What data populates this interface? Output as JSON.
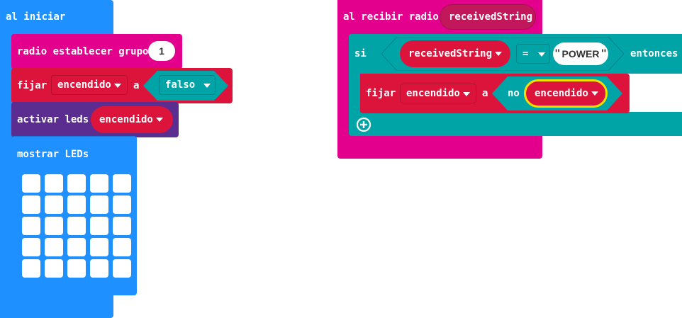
{
  "colors": {
    "basic": "#1E90FF",
    "radio": "#E3008C",
    "variables": "#DC143C",
    "logic": "#00A4A6",
    "led": "#5C2D91"
  },
  "on_start": {
    "label": "al iniciar",
    "radio_set_group": {
      "label": "radio establecer grupo",
      "value": "1"
    },
    "set_var": {
      "label": "fijar",
      "var": "encendido",
      "to": "a",
      "value": "falso"
    },
    "enable_leds": {
      "label": "activar leds",
      "value": "encendido"
    },
    "show_leds": {
      "label": "mostrar LEDs",
      "rows": 5,
      "cols": 5
    }
  },
  "on_radio": {
    "label": "al recibir radio",
    "param": "receivedString",
    "if": {
      "label": "si",
      "left": "receivedString",
      "op": "=",
      "right": "POWER",
      "then": "entonces"
    },
    "set_var": {
      "label": "fijar",
      "var": "encendido",
      "to": "a",
      "not": "no",
      "value": "encendido"
    },
    "add_icon": "plus-circle-icon"
  }
}
